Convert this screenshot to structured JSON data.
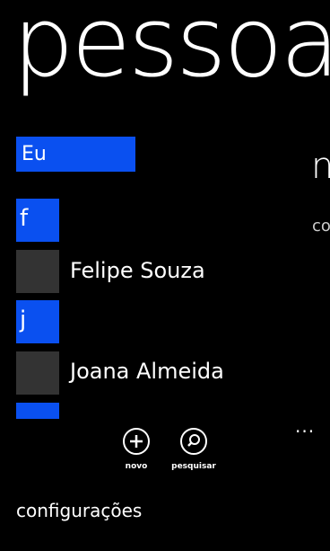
{
  "theme": {
    "accent_color": "#0a50f0",
    "background_color": "#000000"
  },
  "hub": {
    "title": "pessoas",
    "next_pivot_peek": "n",
    "next_pivot_content_peek": "co"
  },
  "me_tile": {
    "label": "Eu"
  },
  "groups": [
    {
      "letter": "f",
      "contacts": [
        {
          "name": "Felipe Souza"
        }
      ]
    },
    {
      "letter": "j",
      "contacts": [
        {
          "name": "Joana Almeida"
        }
      ]
    }
  ],
  "app_bar": {
    "buttons": [
      {
        "icon": "add-icon",
        "label": "novo"
      },
      {
        "icon": "search-icon",
        "label": "pesquisar"
      }
    ],
    "more": "...",
    "menu_items": [
      "configurações"
    ]
  }
}
